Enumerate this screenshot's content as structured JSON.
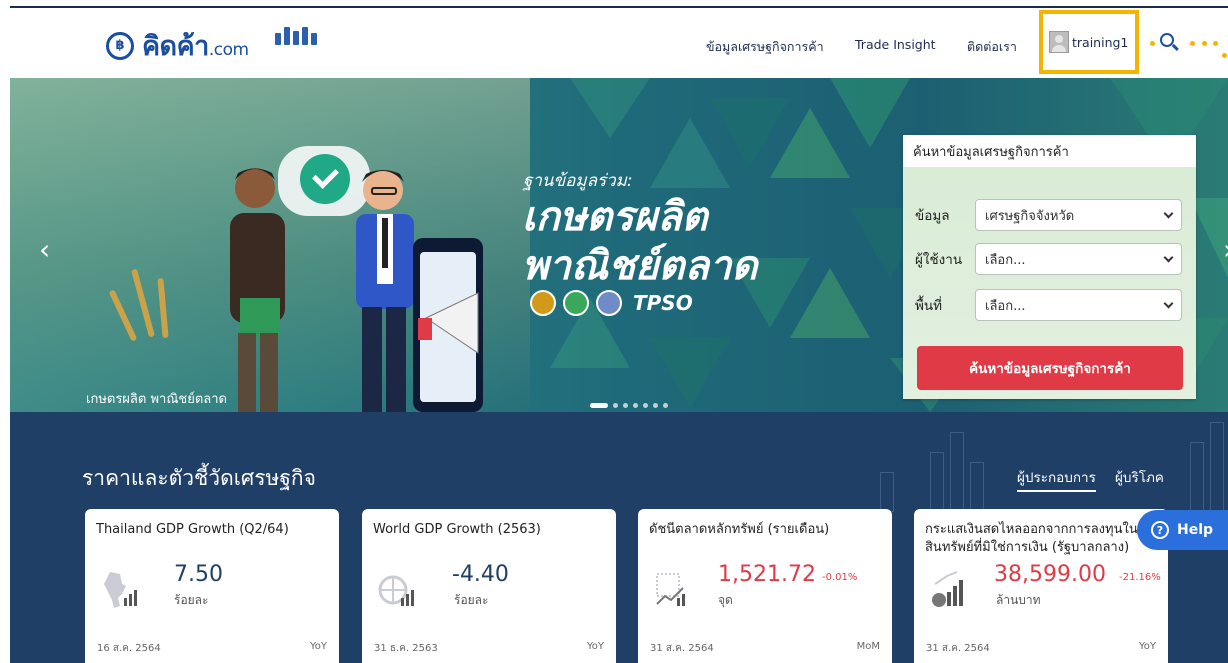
{
  "header": {
    "logo_text": "คิดค้า",
    "logo_suffix": ".com",
    "nav": [
      {
        "label": "ข้อมูลเศรษฐกิจการค้า"
      },
      {
        "label": "Trade Insight"
      },
      {
        "label": "ติดต่อเรา"
      }
    ],
    "user": {
      "name": "training1"
    },
    "search_icon": "search-icon",
    "highlight_color": "#f4b400"
  },
  "banner": {
    "subtitle": "ฐานข้อมูลร่วม:",
    "title_line1": "เกษตรผลิต",
    "title_line2": "พาณิชย์ตลาด",
    "partner_text": "TPSO",
    "caption": "เกษตรผลิต พาณิชย์ตลาด",
    "prev_icon": "chevron-left-icon",
    "next_icon": "chevron-right-icon"
  },
  "search_panel": {
    "heading": "ค้นหาข้อมูลเศรษฐกิจการค้า",
    "fields": [
      {
        "label": "ข้อมูล",
        "value": "เศรษฐกิจจังหวัด"
      },
      {
        "label": "ผู้ใช้งาน",
        "value": "เลือก..."
      },
      {
        "label": "พื้นที่",
        "value": "เลือก..."
      }
    ],
    "submit_label": "ค้นหาข้อมูลเศรษฐกิจการค้า",
    "accent": "#e03a46"
  },
  "economics": {
    "title": "ราคาและตัวชี้วัดเศรษฐกิจ",
    "tabs": [
      {
        "label": "ผู้ประกอบการ",
        "active": true
      },
      {
        "label": "ผู้บริโภค",
        "active": false
      }
    ],
    "cards": [
      {
        "title": "Thailand GDP Growth (Q2/64)",
        "value": "7.50",
        "change": "",
        "unit": "ร้อยละ",
        "date": "16 ส.ค. 2564",
        "period": "YoY",
        "icon": "thailand-map-chart-icon"
      },
      {
        "title": "World GDP Growth (2563)",
        "value": "-4.40",
        "change": "",
        "unit": "ร้อยละ",
        "date": "31 ธ.ค. 2563",
        "period": "YoY",
        "icon": "globe-chart-icon"
      },
      {
        "title": "ดัชนีตลาดหลักทรัพย์ (รายเดือน)",
        "value": "1,521.72",
        "change": "-0.01%",
        "unit": "จุด",
        "date": "31 ส.ค. 2564",
        "period": "MoM",
        "icon": "stock-chart-icon"
      },
      {
        "title": "กระแสเงินสดไหลออกจากการลงทุนในสินทรัพย์ที่มิใช่การเงิน (รัฐบาลกลาง)",
        "value": "38,599.00",
        "change": "-21.16%",
        "unit": "ล้านบาท",
        "date": "31 ส.ค. 2564",
        "period": "YoY",
        "icon": "money-growth-icon"
      }
    ]
  },
  "help": {
    "label": "Help"
  }
}
